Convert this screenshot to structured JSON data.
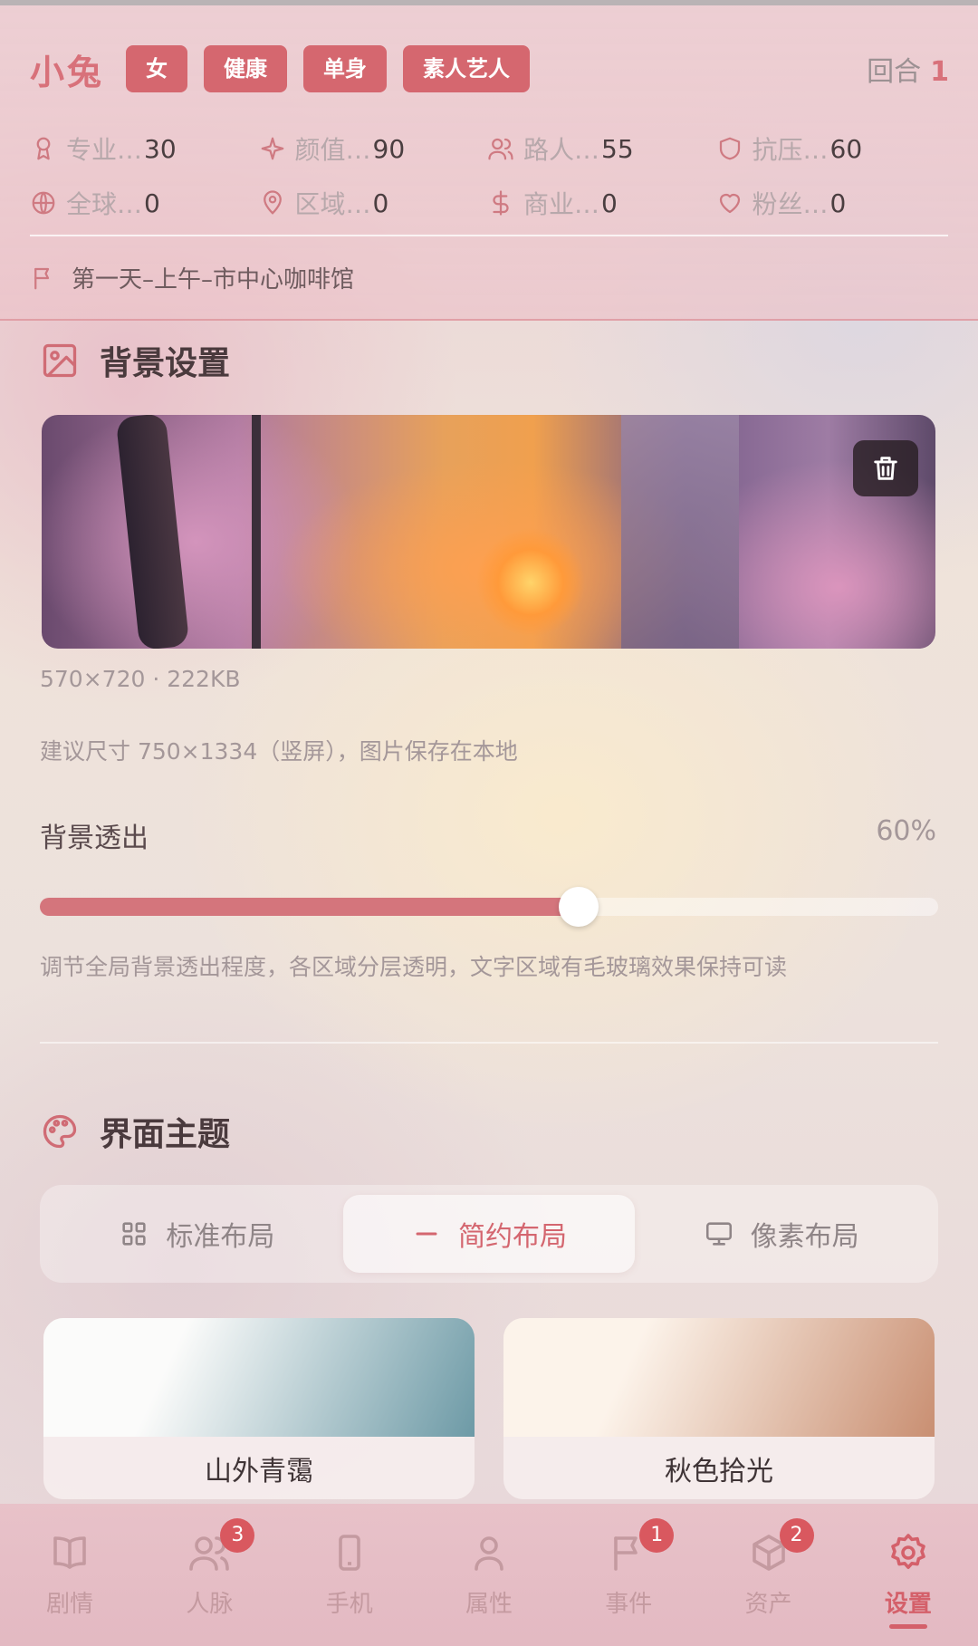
{
  "header": {
    "name": "小兔",
    "tags": [
      "女",
      "健康",
      "单身",
      "素人艺人"
    ],
    "round_label": "回合",
    "round_value": "1",
    "stats": [
      {
        "icon": "medal-icon",
        "label": "专业…",
        "value": "30"
      },
      {
        "icon": "sparkle-icon",
        "label": "颜值…",
        "value": "90"
      },
      {
        "icon": "users-icon",
        "label": "路人…",
        "value": "55"
      },
      {
        "icon": "shield-icon",
        "label": "抗压…",
        "value": "60"
      },
      {
        "icon": "globe-icon",
        "label": "全球…",
        "value": "0"
      },
      {
        "icon": "map-pin-icon",
        "label": "区域…",
        "value": "0"
      },
      {
        "icon": "dollar-icon",
        "label": "商业…",
        "value": "0"
      },
      {
        "icon": "heart-icon",
        "label": "粉丝…",
        "value": "0"
      }
    ],
    "location": "第一天–上午–市中心咖啡馆"
  },
  "background_settings": {
    "title": "背景设置",
    "image_info": "570×720 · 222KB",
    "hint": "建议尺寸 750×1334（竖屏），图片保存在本地",
    "opacity_label": "背景透出",
    "opacity_value": "60%",
    "opacity_fraction": 0.6,
    "opacity_desc": "调节全局背景透出程度，各区域分层透明，文字区域有毛玻璃效果保持可读"
  },
  "theme": {
    "title": "界面主题",
    "layouts": [
      {
        "label": "标准布局",
        "icon": "grid-icon",
        "active": false
      },
      {
        "label": "简约布局",
        "icon": "minus-icon",
        "active": true
      },
      {
        "label": "像素布局",
        "icon": "monitor-icon",
        "active": false
      }
    ],
    "cards": [
      {
        "name": "山外青霭",
        "colors": [
          "#fbfbfa",
          "#6d9aa6"
        ]
      },
      {
        "name": "秋色拾光",
        "colors": [
          "#fcf3ea",
          "#c98f72"
        ]
      }
    ]
  },
  "nav": [
    {
      "label": "剧情",
      "icon": "book-icon",
      "badge": ""
    },
    {
      "label": "人脉",
      "icon": "contacts-icon",
      "badge": "3"
    },
    {
      "label": "手机",
      "icon": "phone-icon",
      "badge": ""
    },
    {
      "label": "属性",
      "icon": "user-icon",
      "badge": ""
    },
    {
      "label": "事件",
      "icon": "flag-icon",
      "badge": "1"
    },
    {
      "label": "资产",
      "icon": "box-icon",
      "badge": "2"
    },
    {
      "label": "设置",
      "icon": "gear-icon",
      "badge": "",
      "active": true
    }
  ],
  "colors": {
    "accent": "#d4666f",
    "tag_bg": "#d5676f",
    "badge": "#d9585f"
  }
}
